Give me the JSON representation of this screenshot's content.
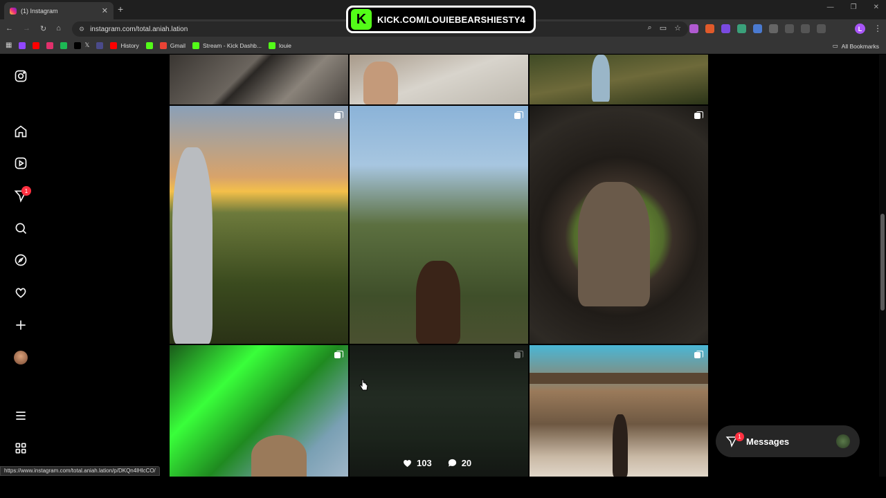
{
  "browser": {
    "tab_title": "(1) Instagram",
    "tab_close": "✕",
    "new_tab": "+",
    "url": "instagram.com/total.aniah.lation",
    "window_controls": [
      "—",
      "❐",
      "✕"
    ],
    "menu": "⋮",
    "profile_letter": "L",
    "bookmarks": [
      {
        "label": "",
        "color": "#9146ff"
      },
      {
        "label": "",
        "color": "#ff0000"
      },
      {
        "label": "",
        "color": "#e1306c"
      },
      {
        "label": "",
        "color": "#1db954"
      },
      {
        "label": "𝕏",
        "color": "#000000"
      },
      {
        "label": "",
        "color": "#4a4a8a"
      },
      {
        "label": "History",
        "color": "#ff0000"
      },
      {
        "label": "",
        "color": "#53fc18"
      },
      {
        "label": "Gmail",
        "color": "#ea4335"
      },
      {
        "label": "Stream - Kick Dashb...",
        "color": "#53fc18"
      },
      {
        "label": "louie",
        "color": "#53fc18"
      }
    ],
    "all_bookmarks": "All Bookmarks",
    "status_url": "https://www.instagram.com/total.aniah.lation/p/DKQn4lHlcCO/"
  },
  "overlay": {
    "kick_logo": "K",
    "kick_text": "KICK.COM/LOUIEBEARSHIESTY4"
  },
  "sidenav": {
    "notification_count": "1"
  },
  "grid": {
    "hovered_post": {
      "likes": "103",
      "comments": "20"
    }
  },
  "messages": {
    "label": "Messages",
    "badge": "1"
  }
}
